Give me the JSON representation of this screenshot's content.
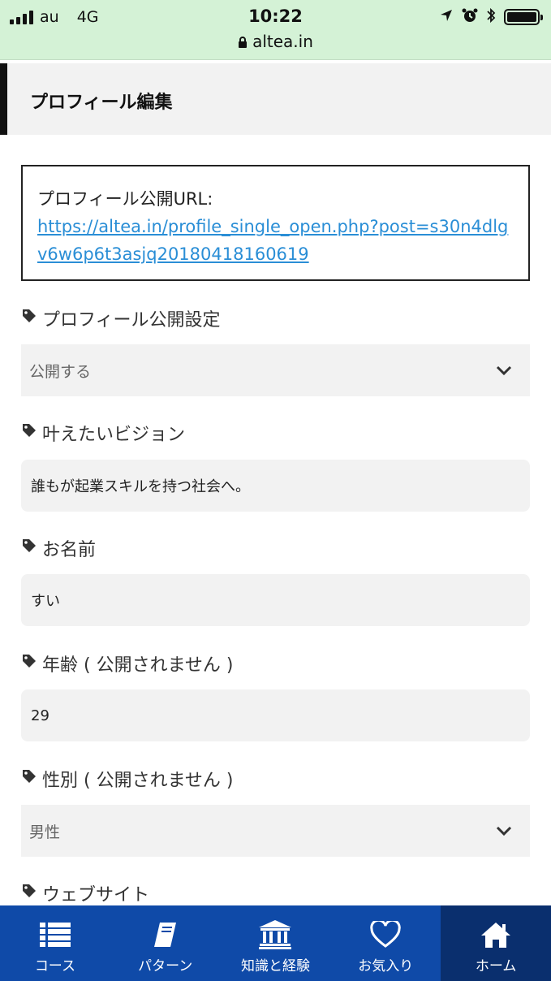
{
  "status_bar": {
    "carrier": "au",
    "network": "4G",
    "time": "10:22",
    "url": "altea.in",
    "battery_level": 1.0
  },
  "header": {
    "title": "プロフィール編集"
  },
  "public_url": {
    "label": "プロフィール公開URL:",
    "link": "https://altea.in/profile_single_open.php?post=s30n4dlgv6w6p6t3asjq20180418160619"
  },
  "fields": {
    "visibility": {
      "label": "プロフィール公開設定",
      "value": "公開する"
    },
    "vision": {
      "label": "叶えたいビジョン",
      "value": "誰もが起業スキルを持つ社会へ。"
    },
    "name": {
      "label": "お名前",
      "value": "すい"
    },
    "age": {
      "label": "年齢 ( 公開されません )",
      "value": "29"
    },
    "gender": {
      "label": "性別 ( 公開されません )",
      "value": "男性"
    },
    "website": {
      "label": "ウェブサイト"
    }
  },
  "nav": {
    "items": [
      {
        "label": "コース",
        "icon": "list-icon"
      },
      {
        "label": "パターン",
        "icon": "book-icon"
      },
      {
        "label": "知識と経験",
        "icon": "bank-icon"
      },
      {
        "label": "お気入り",
        "icon": "heart-icon"
      },
      {
        "label": "ホーム",
        "icon": "home-icon"
      }
    ],
    "active_index": 4
  },
  "colors": {
    "status_bar_bg": "#d4f2d6",
    "nav_bg": "#0f4aa8",
    "nav_active_bg": "#0a2f6e",
    "link": "#2a8ed6"
  }
}
